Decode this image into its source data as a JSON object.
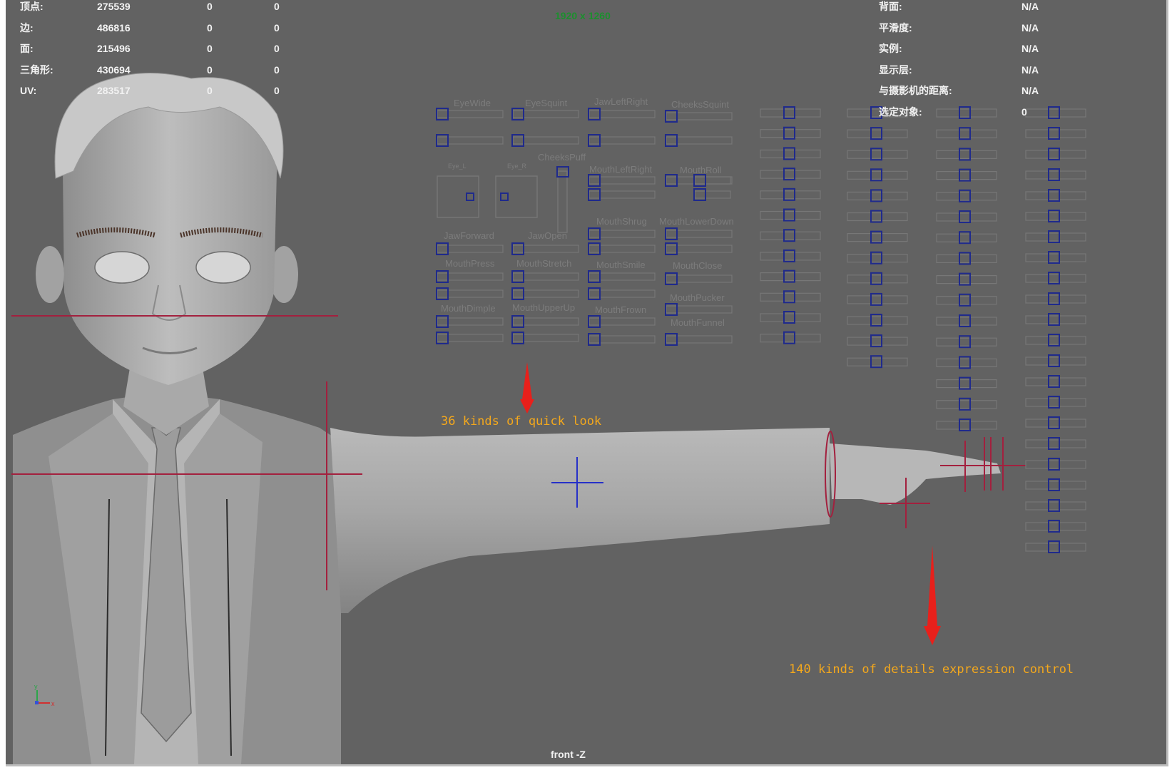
{
  "viewport": {
    "camera_name": "front -Z",
    "resolution_gate": "1920 x 1260"
  },
  "hud_left": [
    {
      "label": "顶点:",
      "total": "275539",
      "selected": "0",
      "components": "0"
    },
    {
      "label": "边:",
      "total": "486816",
      "selected": "0",
      "components": "0"
    },
    {
      "label": "面:",
      "total": "215496",
      "selected": "0",
      "components": "0"
    },
    {
      "label": "三角形:",
      "total": "430694",
      "selected": "0",
      "components": "0"
    },
    {
      "label": "UV:",
      "total": "283517",
      "selected": "0",
      "components": "0"
    }
  ],
  "hud_right": [
    {
      "label": "背面:",
      "value": "N/A"
    },
    {
      "label": "平滑度:",
      "value": "N/A"
    },
    {
      "label": "实例:",
      "value": "N/A"
    },
    {
      "label": "显示层:",
      "value": "N/A"
    },
    {
      "label": "与摄影机的距离:",
      "value": "N/A"
    },
    {
      "label": "选定对象:",
      "value": "0"
    }
  ],
  "face_controls": [
    "EyeWide",
    "EyeSquint",
    "JawLeftRight",
    "CheeksSquint",
    "Eye_L",
    "Eye_R",
    "CheeksPuff",
    "MouthLeftRight",
    "MouthRoll",
    "JawForward",
    "JawOpen",
    "MouthShrug",
    "MouthLowerDown",
    "MouthPress",
    "MouthStretch",
    "MouthSmile",
    "MouthClose",
    "MouthPucker",
    "MouthDimple",
    "MouthUpperUp",
    "MouthFrown",
    "MouthFunnel"
  ],
  "annotations": {
    "quick_look": "36 kinds of quick look",
    "details": "140 kinds of details expression control"
  },
  "colors": {
    "viewport_bg": "#626262",
    "hud_text": "#f2f2f2",
    "gate_text": "#1c8f2e",
    "annotation": "#f4a81c",
    "arrow": "#e8201b",
    "slider_box": "#1f2a8c",
    "rig_line": "#a3203e",
    "pivot": "#2630c8"
  },
  "axis_gizmo": {
    "y": "y",
    "x": "x"
  }
}
